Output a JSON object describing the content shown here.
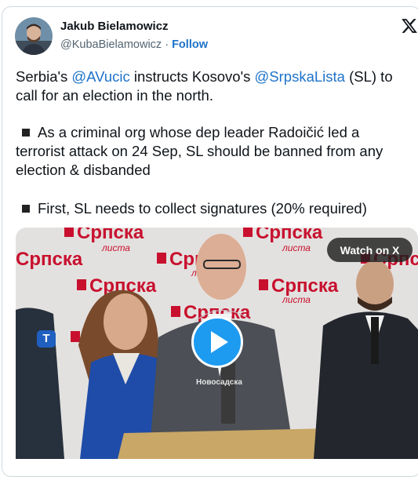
{
  "author": {
    "name": "Jakub Bielamowicz",
    "handle": "@KubaBielamowicz",
    "separator": "·",
    "follow_label": "Follow"
  },
  "icons": {
    "avatar": "user-avatar",
    "brand": "x-logo-icon",
    "play": "play-icon",
    "bullet": "black-square-icon",
    "channel": "tv-channel-logo"
  },
  "tweet": {
    "line1_a": "Serbia's ",
    "mention1": "@AVucic",
    "line1_b": " instructs Kosovo's ",
    "mention2": "@SrpskaLista",
    "line1_c": " (SL) to",
    "line2": "call for an election in the north.",
    "bullet1_line1": "As a criminal org whose dep leader Radoičić led a",
    "bullet1_line2": "terrorist attack on 24 Sep, SL should be banned from any",
    "bullet1_line3": "election & disbanded",
    "bullet2": "First, SL needs to collect signatures (20% required)"
  },
  "media": {
    "watch_label": "Watch on X",
    "backdrop_brand": "Српска",
    "backdrop_sub": "листа",
    "channel_watermark": "Новосадска",
    "channel_letter": "T"
  },
  "colors": {
    "link": "#1d73c9",
    "play": "#1d9bf0",
    "backdrop_red": "#c8102e"
  }
}
